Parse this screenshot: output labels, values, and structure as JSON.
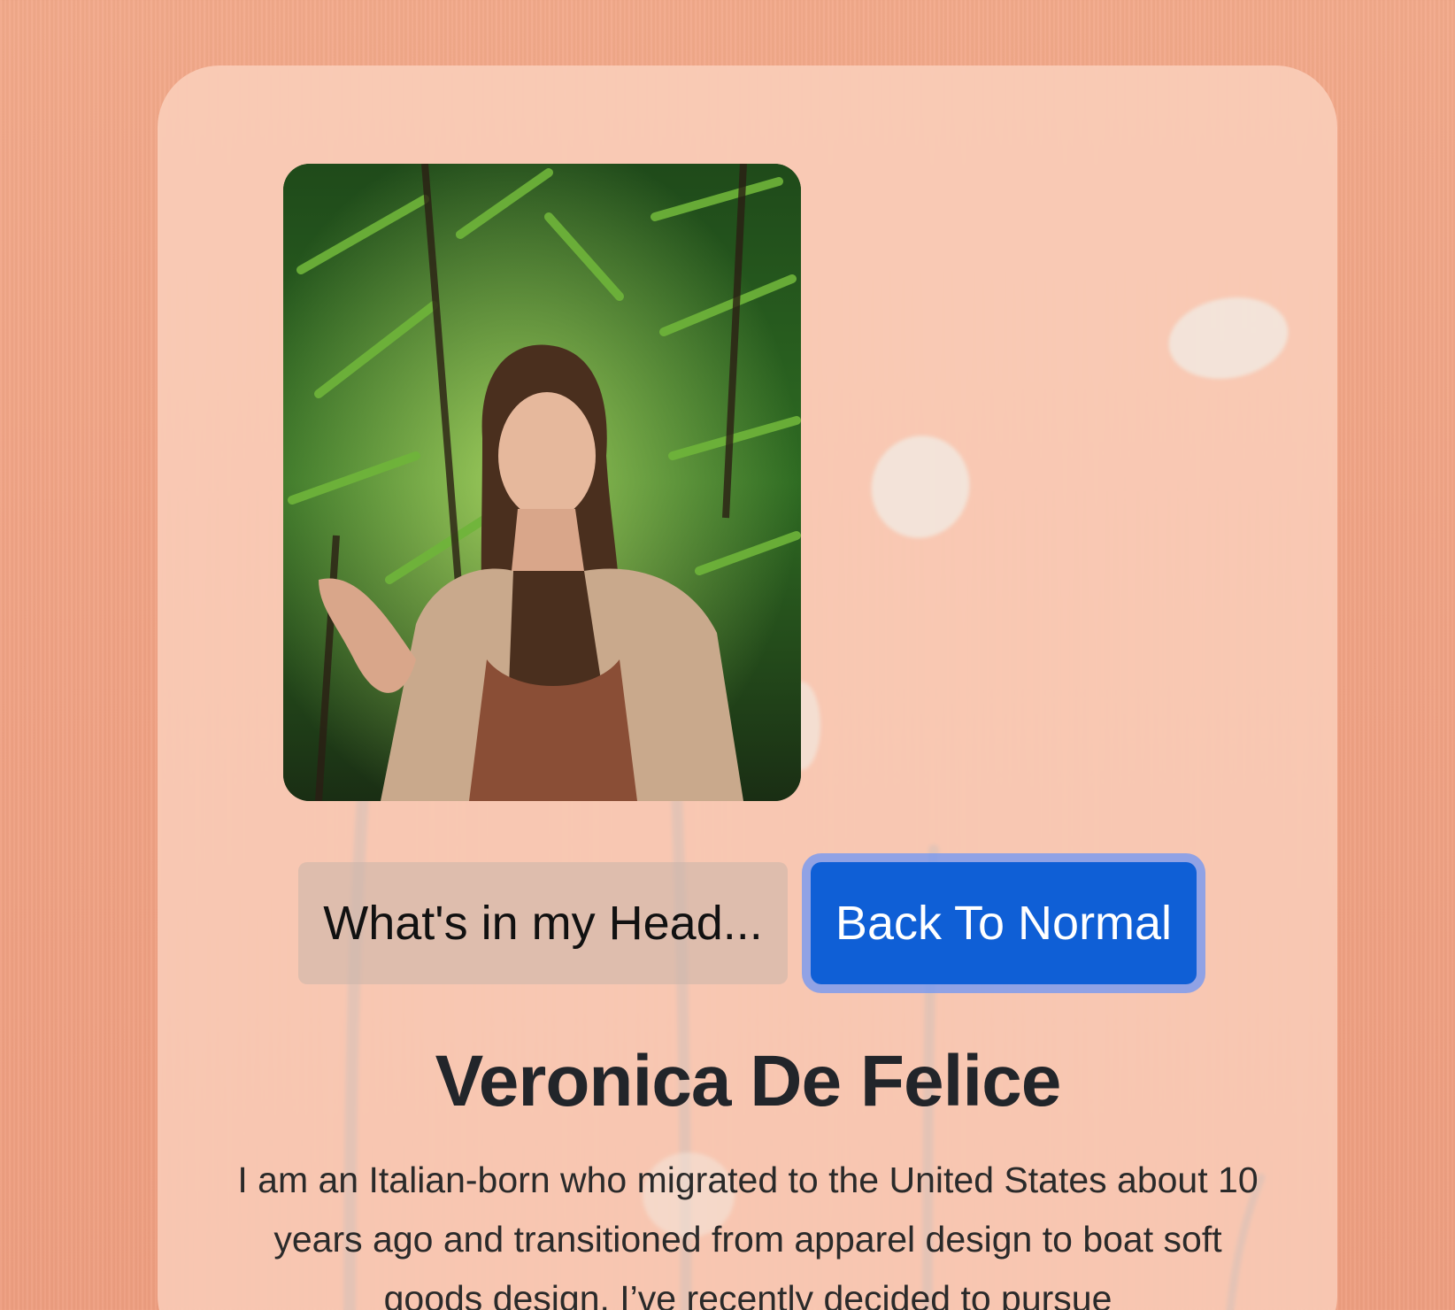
{
  "profile": {
    "photo_alt": "Veronica De Felice",
    "name": "Veronica De Felice",
    "bio": "I am an Italian-born who migrated to the United States about 10 years ago and transitioned from apparel design to boat soft goods design. I’ve recently decided to pursue"
  },
  "buttons": {
    "head_label": "What's in my Head...",
    "normal_label": "Back To Normal"
  },
  "colors": {
    "background": "#f0a284",
    "card": "#ffdece",
    "primary_button": "#0f5fd6",
    "secondary_button": "#c8b4aa",
    "name_text": "#22252a"
  }
}
